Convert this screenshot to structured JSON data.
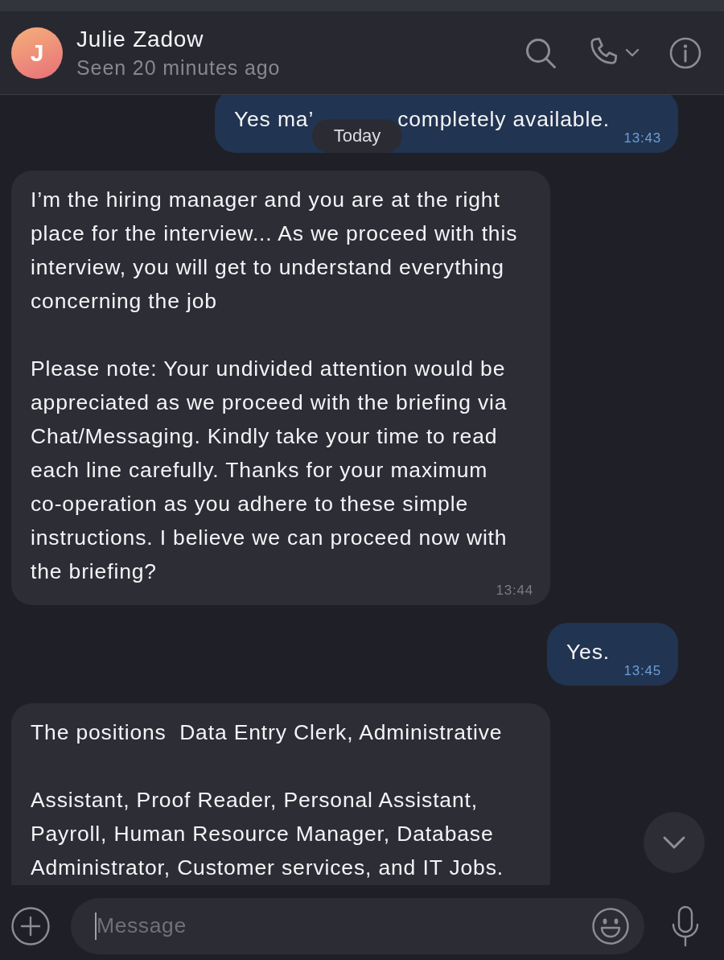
{
  "header": {
    "avatar_initial": "J",
    "name": "Julie Zadow",
    "status": "Seen 20 minutes ago"
  },
  "date_divider": "Today",
  "messages": [
    {
      "kind": "outgoing",
      "fragments": [
        "Yes ma’",
        "completely available."
      ],
      "time": "13:43"
    },
    {
      "kind": "incoming",
      "paragraphs": [
        "I’m the hiring manager and you are at the right place for the interview... As we proceed with this interview, you will get to understand everything concerning the job",
        "Please note: Your undivided attention would be appreciated as we proceed with the briefing via Chat/Messaging. Kindly take your time to read each line carefully. Thanks for your maximum co-operation as you adhere to these simple instructions. I believe we can proceed now with the briefing?"
      ],
      "time": "13:44"
    },
    {
      "kind": "outgoing",
      "paragraphs": [
        "Yes."
      ],
      "time": "13:45"
    },
    {
      "kind": "incoming",
      "paragraphs": [
        "The positions  Data Entry Clerk, Administrative",
        "Assistant, Proof Reader, Personal Assistant, Payroll, Human Resource Manager, Database Administrator, Customer services, and IT Jobs."
      ]
    }
  ],
  "composer": {
    "placeholder": "Message"
  }
}
